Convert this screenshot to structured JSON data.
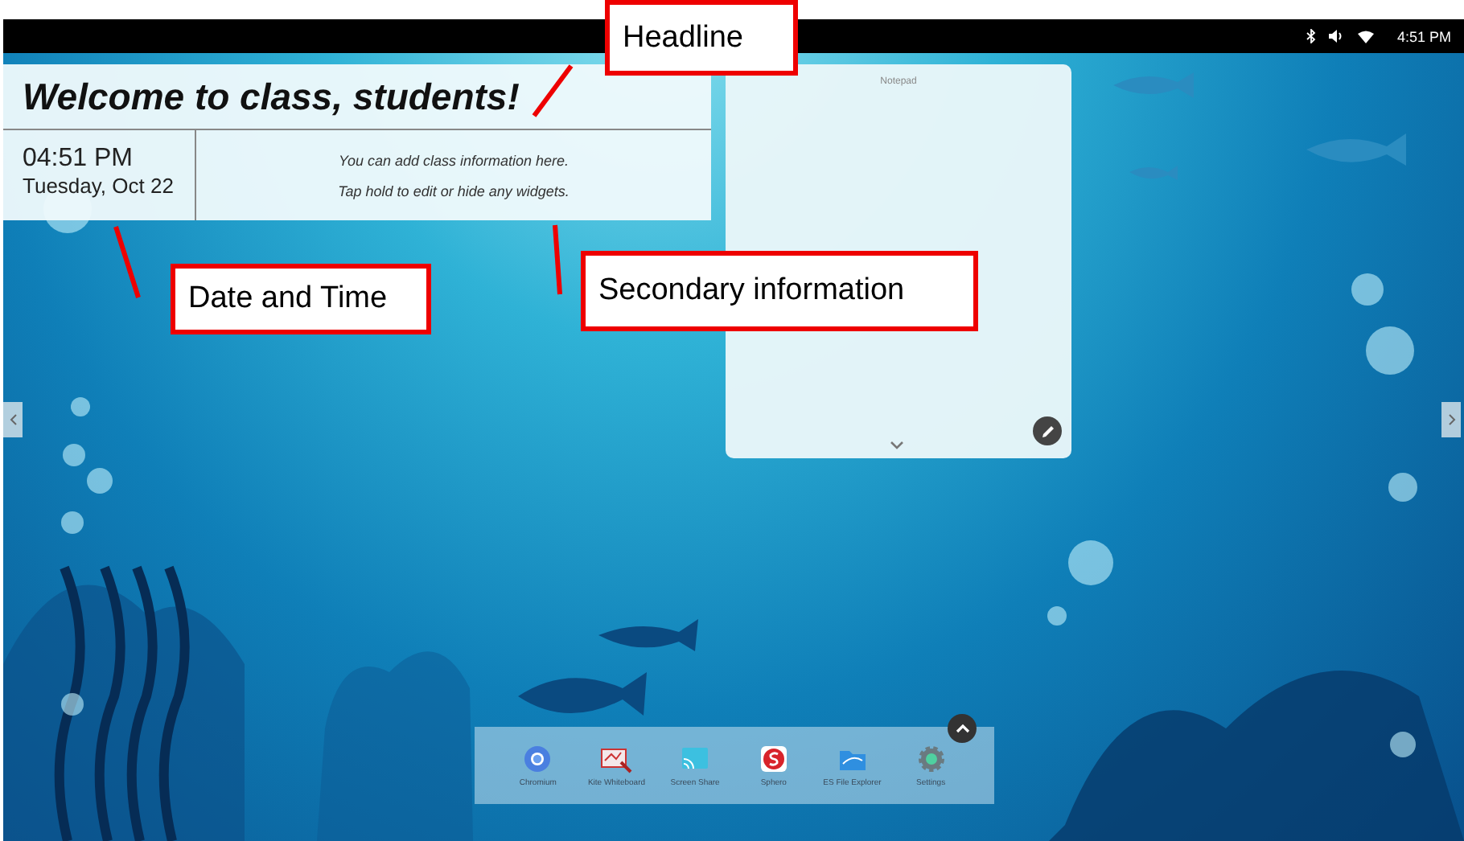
{
  "status_bar": {
    "time": "4:51 PM"
  },
  "welcome_widget": {
    "headline": "Welcome to class, students!",
    "time": "04:51 PM",
    "date": "Tuesday, Oct 22",
    "info_lines": [
      "You can add class information here.",
      "Tap hold to edit or hide any widgets."
    ]
  },
  "notepad": {
    "title": "Notepad"
  },
  "dock": {
    "apps": [
      {
        "label": "Chromium",
        "kind": "browser"
      },
      {
        "label": "Kite Whiteboard",
        "kind": "whiteboard"
      },
      {
        "label": "Screen Share",
        "kind": "cast"
      },
      {
        "label": "Sphero",
        "kind": "sphero"
      },
      {
        "label": "ES File Explorer",
        "kind": "files"
      },
      {
        "label": "Settings",
        "kind": "settings"
      }
    ]
  },
  "callouts": [
    {
      "label": "Headline",
      "kind": "headline"
    },
    {
      "label": "Date and Time",
      "kind": "datetime"
    },
    {
      "label": "Secondary information",
      "kind": "secondary"
    }
  ]
}
